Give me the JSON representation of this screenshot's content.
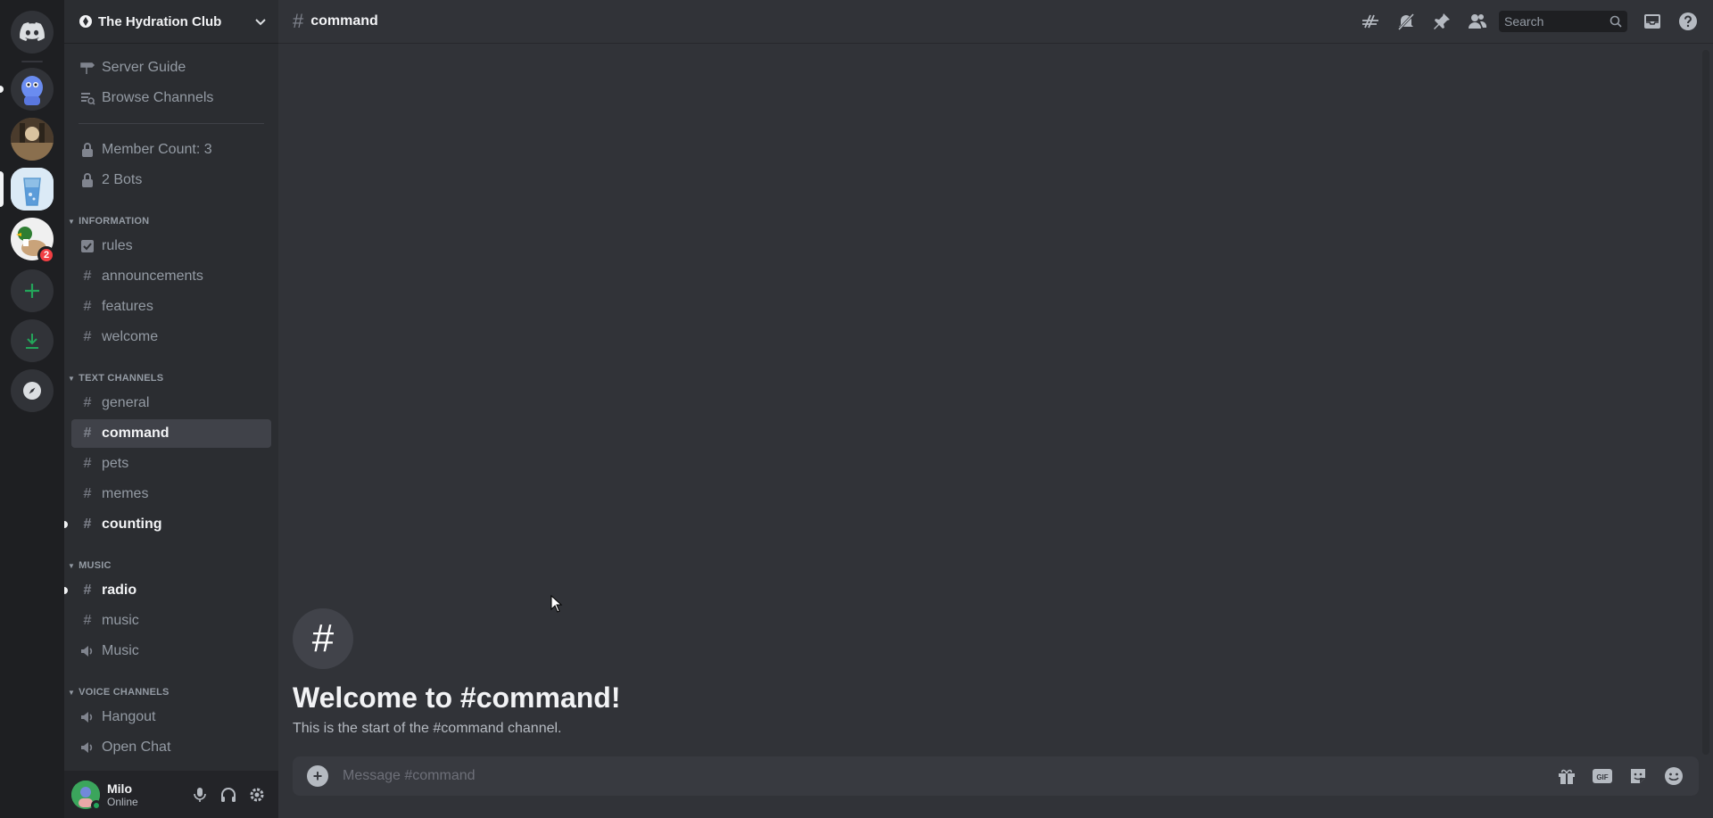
{
  "server_list": {
    "items": [
      {
        "name": "Direct Messages",
        "icon": "discord-logo-icon"
      },
      {
        "name": "Blue mascot server",
        "icon": "server-avatar"
      },
      {
        "name": "Photo server",
        "icon": "server-avatar"
      },
      {
        "name": "The Hydration Club",
        "icon": "server-avatar",
        "selected": true
      },
      {
        "name": "Duck server",
        "icon": "server-avatar",
        "mentions": "2"
      },
      {
        "name": "Add a Server",
        "icon": "plus-icon"
      },
      {
        "name": "Download Apps",
        "icon": "download-icon"
      },
      {
        "name": "Explore Discoverable Servers",
        "icon": "compass-icon"
      }
    ]
  },
  "guild": {
    "name": "The Hydration Club"
  },
  "sidebar": {
    "top_items": [
      {
        "label": "Server Guide",
        "icon": "signpost-icon"
      },
      {
        "label": "Browse Channels",
        "icon": "browse-channels-icon"
      }
    ],
    "locked_items": [
      {
        "label": "Member Count: 3",
        "icon": "lock-icon"
      },
      {
        "label": "2 Bots",
        "icon": "lock-icon"
      }
    ],
    "categories": {
      "information": {
        "title": "INFORMATION",
        "channels": [
          {
            "label": "rules",
            "icon": "rules-icon"
          },
          {
            "label": "announcements",
            "icon": "hash-icon"
          },
          {
            "label": "features",
            "icon": "hash-icon"
          },
          {
            "label": "welcome",
            "icon": "hash-icon"
          }
        ]
      },
      "text": {
        "title": "TEXT CHANNELS",
        "channels": [
          {
            "label": "general",
            "icon": "hash-icon"
          },
          {
            "label": "command",
            "icon": "hash-icon",
            "active": true
          },
          {
            "label": "pets",
            "icon": "hash-icon"
          },
          {
            "label": "memes",
            "icon": "hash-icon"
          },
          {
            "label": "counting",
            "icon": "hash-icon",
            "unread": true
          }
        ]
      },
      "music": {
        "title": "MUSIC",
        "channels": [
          {
            "label": "radio",
            "icon": "hash-icon",
            "unread": true
          },
          {
            "label": "music",
            "icon": "hash-icon"
          },
          {
            "label": "Music",
            "icon": "speaker-icon"
          }
        ]
      },
      "voice": {
        "title": "VOICE CHANNELS",
        "channels": [
          {
            "label": "Hangout",
            "icon": "speaker-icon"
          },
          {
            "label": "Open Chat",
            "icon": "speaker-icon"
          }
        ]
      }
    }
  },
  "user": {
    "name": "Milo",
    "status": "Online"
  },
  "header": {
    "channel": "command",
    "search_placeholder": "Search"
  },
  "welcome": {
    "title": "Welcome to #command!",
    "subtitle": "This is the start of the #command channel."
  },
  "composer": {
    "placeholder": "Message #command"
  },
  "colors": {
    "accent": "#5865f2",
    "online": "#23a55a",
    "mention_badge": "#f23f43",
    "add_server_green": "#23a55a"
  }
}
